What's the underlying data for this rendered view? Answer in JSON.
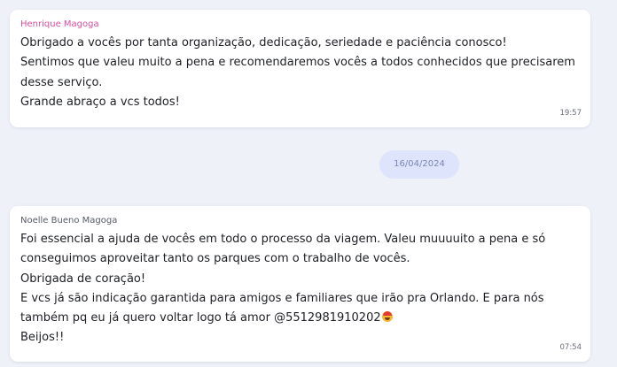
{
  "colors": {
    "background": "#eef1f8",
    "bubble": "#ffffff",
    "date_pill": "#dde4fb",
    "date_text": "#7b86b3"
  },
  "messages": [
    {
      "sender": "Henrique Magoga",
      "sender_color": "#d94fa0",
      "lines": [
        "Obrigado a vocês por tanta organização, dedicação, seriedade e paciência conosco!",
        "Sentimos que valeu muito a pena e recomendaremos vocês a todos conhecidos que precisarem",
        "desse serviço.",
        "Grande abraço a vcs todos!"
      ],
      "time": "19:57"
    },
    {
      "sender": "Noelle Bueno Magoga",
      "sender_color": "#555a66",
      "lines": [
        "Foi essencial a ajuda de vocês em todo o processo da viagem. Valeu muuuuito a pena e só",
        "conseguimos aproveitar tanto os parques com o trabalho de vocês.",
        "Obrigada de coração!",
        "E vcs já são indicação garantida para amigos e familiares que irão pra Orlando. E para nós",
        "também pq eu já quero voltar logo tá amor @5512981910202",
        "Beijos!!"
      ],
      "emoji": "laughing-face-with-party-hat",
      "time": "07:54"
    }
  ],
  "date_separator": "16/04/2024"
}
